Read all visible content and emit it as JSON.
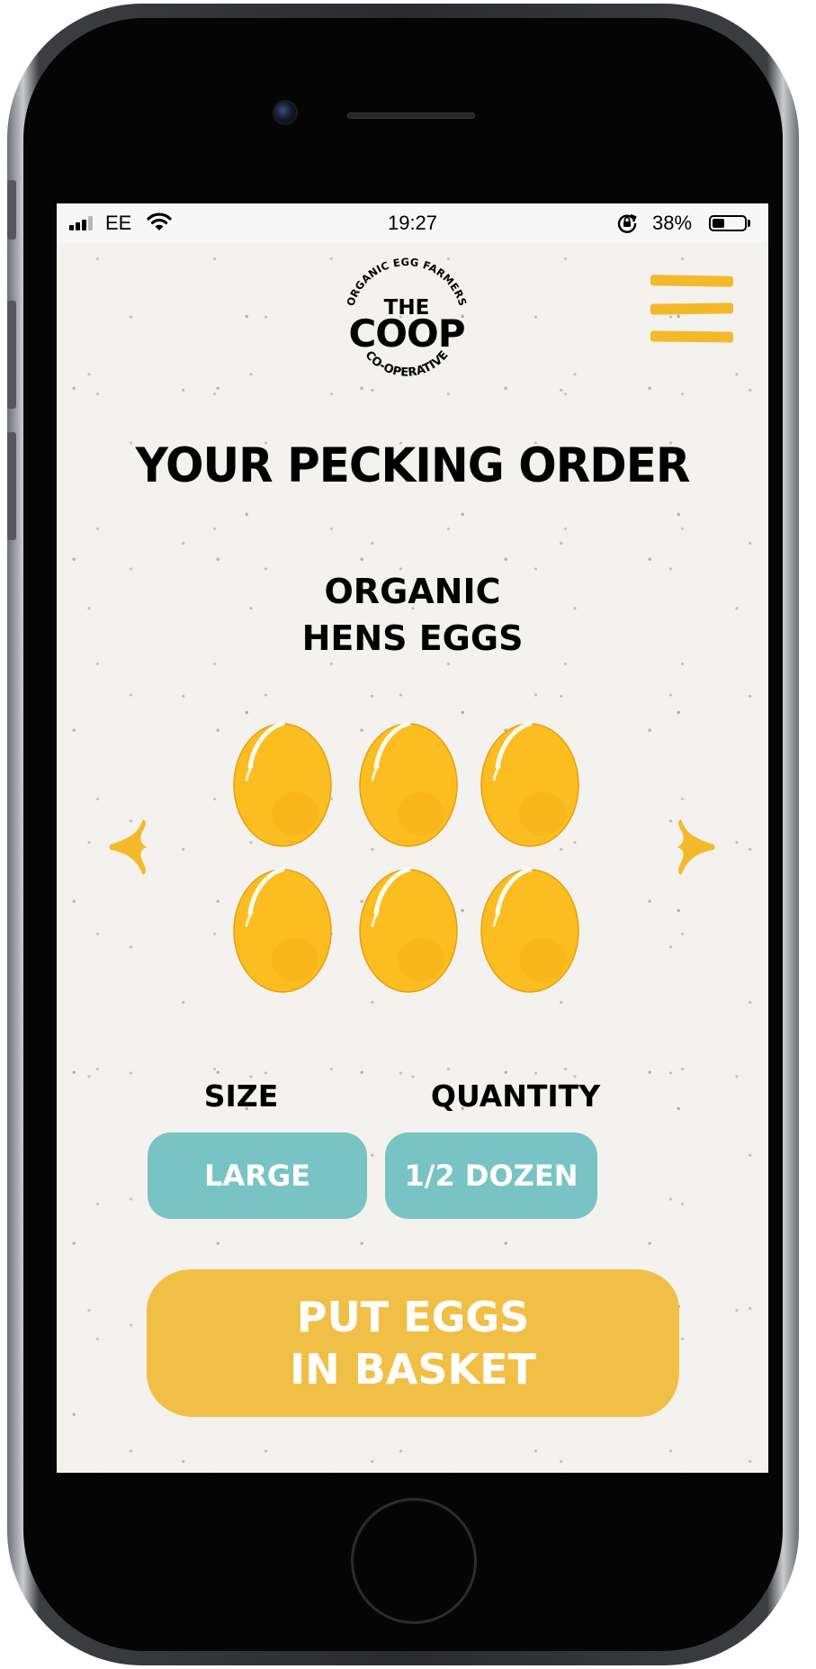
{
  "status_bar": {
    "carrier": "EE",
    "time": "19:27",
    "battery_percent": "38%",
    "battery_level": 0.38
  },
  "brand": {
    "ring_top": "ORGANIC EGG FARMERS",
    "line1": "THE",
    "line2": "COOP",
    "ring_bottom": "CO-OPERATIVE"
  },
  "page": {
    "title": "YOUR PECKING ORDER"
  },
  "product": {
    "line1": "ORGANIC",
    "line2": "HENS EGGS",
    "egg_count": 6
  },
  "options": {
    "size_label": "SIZE",
    "size_value": "LARGE",
    "quantity_label": "QUANTITY",
    "quantity_value": "1/2 DOZEN"
  },
  "cta": {
    "line1": "PUT EGGS",
    "line2": "IN BASKET"
  },
  "icons": {
    "menu": "hamburger-menu-icon",
    "prev": "arrow-left-icon",
    "next": "arrow-right-icon",
    "egg": "egg-icon"
  },
  "colors": {
    "accent_yellow": "#f4b92b",
    "egg_yellow": "#fbbd1f",
    "teal": "#78c3c3",
    "cta_yellow": "#f1bf45",
    "text_black": "#000000"
  }
}
